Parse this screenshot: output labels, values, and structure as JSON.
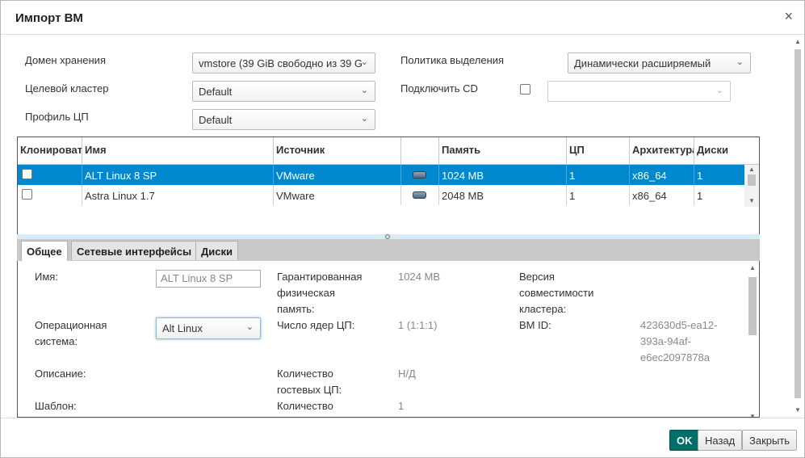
{
  "dialog": {
    "title": "Импорт ВМ",
    "close_glyph": "×"
  },
  "form": {
    "storage_domain_label": "Домен хранения",
    "storage_domain_value": "vmstore (39 GiB свободно из 39 G",
    "target_cluster_label": "Целевой кластер",
    "target_cluster_value": "Default",
    "cpu_profile_label": "Профиль ЦП",
    "cpu_profile_value": "Default",
    "allocation_policy_label": "Политика выделения",
    "allocation_policy_value": "Динамически расширяемый",
    "attach_cd_label": "Подключить CD",
    "attach_cd_checked": false,
    "attach_cd_value": ""
  },
  "grid": {
    "columns": [
      "Клонироват",
      "Имя",
      "Источник",
      "",
      "Память",
      "ЦП",
      "Архитектура",
      "Диски"
    ],
    "rows": [
      {
        "clone": false,
        "name": "ALT Linux 8 SP",
        "source": "VMware",
        "icon": "disk-icon",
        "memory": "1024 MB",
        "cpu": "1",
        "arch": "x86_64",
        "disks": "1",
        "selected": true
      },
      {
        "clone": false,
        "name": "Astra Linux 1.7",
        "source": "VMware",
        "icon": "disk-icon",
        "memory": "2048 MB",
        "cpu": "1",
        "arch": "x86_64",
        "disks": "1",
        "selected": false
      }
    ]
  },
  "tabs": [
    {
      "label": "Общее",
      "active": true
    },
    {
      "label": "Сетевые интерфейсы",
      "active": false
    },
    {
      "label": "Диски",
      "active": false
    }
  ],
  "general": {
    "name_label": "Имя:",
    "name_value": "ALT Linux 8 SP",
    "os_label_1": "Операционная",
    "os_label_2": "система:",
    "os_value": "Alt Linux",
    "desc_label": "Описание:",
    "template_label": "Шаблон:",
    "guaranteed_mem_label_1": "Гарантированная",
    "guaranteed_mem_label_2": "физическая",
    "guaranteed_mem_label_3": "память:",
    "guaranteed_mem_value": "1024 MB",
    "cpu_cores_label": "Число ядер ЦП:",
    "cpu_cores_value": "1 (1:1:1)",
    "guest_cpu_label_1": "Количество",
    "guest_cpu_label_2": "гостевых ЦП:",
    "guest_cpu_value": "Н/Д",
    "count_label": "Количество",
    "count_value": "1",
    "compat_label_1": "Версия",
    "compat_label_2": "совместимости",
    "compat_label_3": "кластера:",
    "vm_id_label": "ВМ ID:",
    "vm_id_value_1": "423630d5-ea12-",
    "vm_id_value_2": "393a-94af-",
    "vm_id_value_3": "e6ec2097878a"
  },
  "footer": {
    "ok_label": "OK",
    "back_label": "Назад",
    "close_label": "Закрыть"
  },
  "colors": {
    "selected_row": "#0088ce",
    "primary_button": "#006e6b"
  }
}
